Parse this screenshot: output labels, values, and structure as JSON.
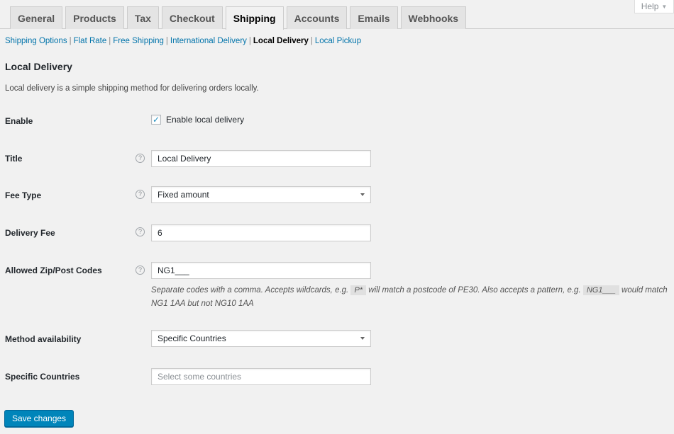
{
  "help": {
    "label": "Help"
  },
  "tabs": [
    {
      "label": "General",
      "active": false
    },
    {
      "label": "Products",
      "active": false
    },
    {
      "label": "Tax",
      "active": false
    },
    {
      "label": "Checkout",
      "active": false
    },
    {
      "label": "Shipping",
      "active": true
    },
    {
      "label": "Accounts",
      "active": false
    },
    {
      "label": "Emails",
      "active": false
    },
    {
      "label": "Webhooks",
      "active": false
    }
  ],
  "sections": [
    {
      "label": "Shipping Options",
      "current": false
    },
    {
      "label": "Flat Rate",
      "current": false
    },
    {
      "label": "Free Shipping",
      "current": false
    },
    {
      "label": "International Delivery",
      "current": false
    },
    {
      "label": "Local Delivery",
      "current": true
    },
    {
      "label": "Local Pickup",
      "current": false
    }
  ],
  "section_separator": "|",
  "page": {
    "title": "Local Delivery",
    "description": "Local delivery is a simple shipping method for delivering orders locally."
  },
  "tooltip_glyph": "?",
  "fields": {
    "enable": {
      "label": "Enable",
      "checkbox_label": "Enable local delivery",
      "checked": true,
      "check_glyph": "✓"
    },
    "title": {
      "label": "Title",
      "value": "Local Delivery"
    },
    "fee_type": {
      "label": "Fee Type",
      "value": "Fixed amount"
    },
    "delivery_fee": {
      "label": "Delivery Fee",
      "value": "6"
    },
    "codes": {
      "label": "Allowed Zip/Post Codes",
      "value": "NG1___",
      "desc_1": "Separate codes with a comma. Accepts wildcards, e.g. ",
      "desc_code_1": "P*",
      "desc_2": " will match a postcode of PE30. Also accepts a pattern, e.g. ",
      "desc_code_2": "NG1___",
      "desc_3": " would match NG1 1AA but not NG10 1AA"
    },
    "availability": {
      "label": "Method availability",
      "value": "Specific Countries"
    },
    "countries": {
      "label": "Specific Countries",
      "placeholder": "Select some countries"
    }
  },
  "save_button": {
    "label": "Save changes"
  },
  "colors": {
    "accent": "#0085ba",
    "link": "#0073aa",
    "check": "#1e8cbe"
  }
}
